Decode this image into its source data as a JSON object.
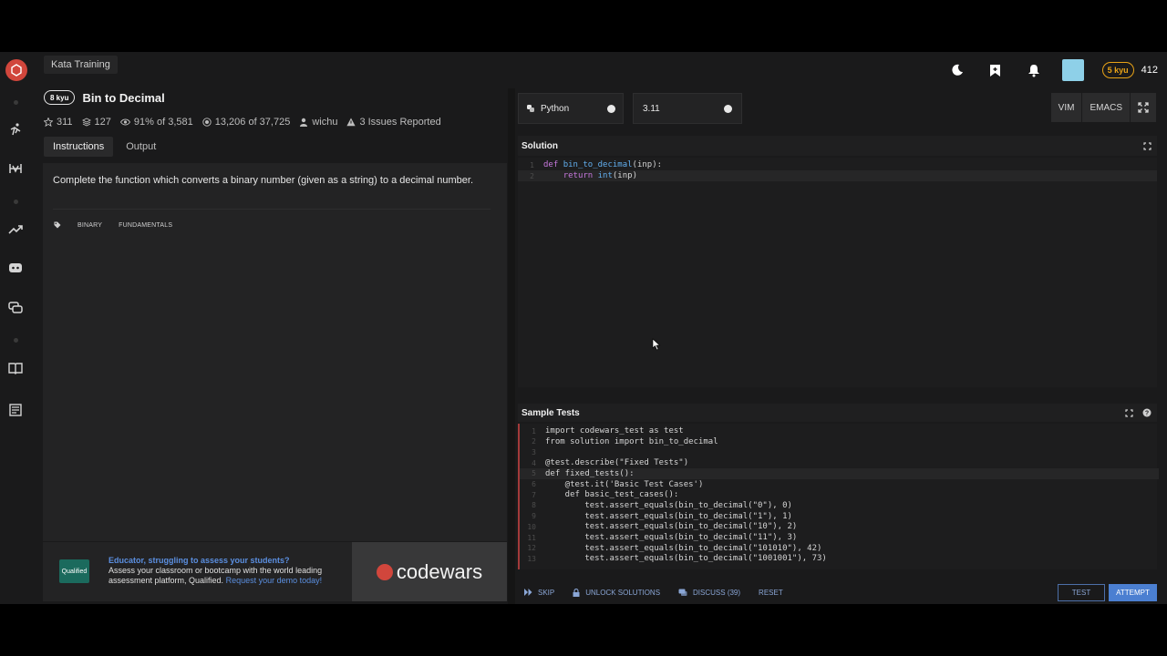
{
  "breadcrumb": "Kata Training",
  "kata": {
    "rank": "8 kyu",
    "title": "Bin to Decimal",
    "stars": "311",
    "collections": "127",
    "satisfaction": "91% of 3,581",
    "completed": "13,206 of 37,725",
    "author": "wichu",
    "issues": "3 Issues Reported"
  },
  "tabs": [
    "Instructions",
    "Output"
  ],
  "description": "Complete the function which converts a binary number (given as a string) to a decimal number.",
  "tags": [
    "BINARY",
    "FUNDAMENTALS"
  ],
  "user": {
    "rank": "5 kyu",
    "honor": "412"
  },
  "ad": {
    "logo_text": "Qualified",
    "headline": "Educator, struggling to assess your students?",
    "body": "Assess your classroom or bootcamp with the world leading assessment platform, Qualified.",
    "link": "Request your demo today!",
    "brand": "codewars"
  },
  "language": "Python",
  "version": "3.11",
  "modes": [
    "VIM",
    "EMACS"
  ],
  "solution": {
    "title": "Solution",
    "lines": [
      [
        "1",
        "def bin_to_decimal(inp):"
      ],
      [
        "2",
        "    return int(inp)"
      ]
    ]
  },
  "tests": {
    "title": "Sample Tests",
    "line_numbers": [
      "1",
      "2",
      "3",
      "4",
      "5",
      "6",
      "7",
      "8",
      "9",
      "10",
      "11",
      "12",
      "13"
    ],
    "lines": [
      "import codewars_test as test",
      "from solution import bin_to_decimal",
      "",
      "@test.describe(\"Fixed Tests\")",
      "def fixed_tests():",
      "    @test.it('Basic Test Cases')",
      "    def basic_test_cases():",
      "        test.assert_equals(bin_to_decimal(\"0\"), 0)",
      "        test.assert_equals(bin_to_decimal(\"1\"), 1)",
      "        test.assert_equals(bin_to_decimal(\"10\"), 2)",
      "        test.assert_equals(bin_to_decimal(\"11\"), 3)",
      "        test.assert_equals(bin_to_decimal(\"101010\"), 42)",
      "        test.assert_equals(bin_to_decimal(\"1001001\"), 73)"
    ]
  },
  "actions": {
    "skip": "SKIP",
    "unlock": "UNLOCK SOLUTIONS",
    "discuss": "DISCUSS (39)",
    "reset": "RESET",
    "test": "TEST",
    "attempt": "ATTEMPT"
  }
}
